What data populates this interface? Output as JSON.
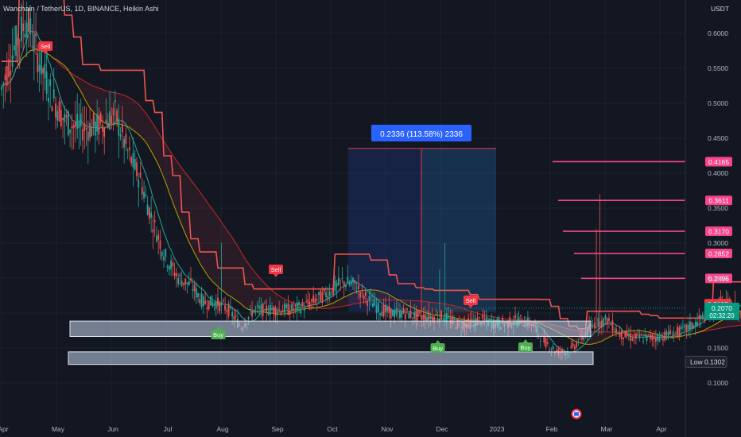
{
  "header": {
    "title": "Wanchain / TetherUS, 1D, BINANCE, Heikin Ashi",
    "currency": "USDT"
  },
  "chart_data": {
    "type": "candlestick",
    "yaxis_ticks": [
      0.6,
      0.55,
      0.5,
      0.45,
      0.4,
      0.35,
      0.3,
      0.25,
      0.2,
      0.15,
      0.1
    ],
    "yaxis_tick_labels": [
      "0.6000",
      "0.5500",
      "0.5000",
      "0.4500",
      "0.4000",
      "0.3500",
      "0.3000",
      "0.2500",
      "0.2000",
      "0.1500",
      "0.1000"
    ],
    "ylim": [
      0.0535,
      0.6335
    ],
    "xaxis_labels": [
      "Apr",
      "May",
      "Jun",
      "Jul",
      "Aug",
      "Sep",
      "Oct",
      "Nov",
      "Dec",
      "2023",
      "Feb",
      "Mar",
      "Apr"
    ],
    "price_path": [
      [
        0,
        0.5,
        0.54
      ],
      [
        1,
        0.56,
        0.6
      ],
      [
        2,
        0.58,
        0.66
      ],
      [
        3,
        0.55,
        0.57
      ],
      [
        4,
        0.5,
        0.52
      ],
      [
        5,
        0.47,
        0.48
      ],
      [
        6,
        0.46,
        0.47
      ],
      [
        7,
        0.47,
        0.46
      ],
      [
        8,
        0.48,
        0.46
      ],
      [
        9,
        0.5,
        0.47
      ],
      [
        10,
        0.45,
        0.41
      ],
      [
        11,
        0.42,
        0.36
      ],
      [
        12,
        0.36,
        0.3
      ],
      [
        13,
        0.3,
        0.26
      ],
      [
        14,
        0.26,
        0.24
      ],
      [
        15,
        0.25,
        0.23
      ],
      [
        16,
        0.22,
        0.21
      ],
      [
        17,
        0.21,
        0.22
      ],
      [
        18,
        0.22,
        0.19
      ],
      [
        19,
        0.19,
        0.17
      ],
      [
        20,
        0.2,
        0.21
      ],
      [
        21,
        0.21,
        0.2
      ],
      [
        22,
        0.2,
        0.21
      ],
      [
        23,
        0.21,
        0.2
      ],
      [
        24,
        0.2,
        0.22
      ],
      [
        25,
        0.23,
        0.21
      ],
      [
        26,
        0.22,
        0.24
      ],
      [
        27,
        0.24,
        0.25
      ],
      [
        28,
        0.25,
        0.23
      ],
      [
        29,
        0.23,
        0.21
      ],
      [
        30,
        0.21,
        0.2
      ],
      [
        31,
        0.2,
        0.2
      ],
      [
        32,
        0.2,
        0.2
      ],
      [
        33,
        0.2,
        0.19
      ],
      [
        34,
        0.19,
        0.2
      ],
      [
        35,
        0.2,
        0.19
      ],
      [
        36,
        0.19,
        0.18
      ],
      [
        37,
        0.18,
        0.19
      ],
      [
        38,
        0.19,
        0.19
      ],
      [
        39,
        0.19,
        0.18
      ],
      [
        40,
        0.18,
        0.19
      ],
      [
        41,
        0.19,
        0.19
      ],
      [
        42,
        0.19,
        0.18
      ],
      [
        43,
        0.17,
        0.15
      ],
      [
        44,
        0.15,
        0.14
      ],
      [
        45,
        0.14,
        0.15
      ],
      [
        46,
        0.15,
        0.18
      ],
      [
        47,
        0.17,
        0.2
      ],
      [
        48,
        0.2,
        0.18
      ],
      [
        49,
        0.18,
        0.16
      ],
      [
        50,
        0.16,
        0.17
      ],
      [
        51,
        0.17,
        0.16
      ],
      [
        52,
        0.16,
        0.17
      ],
      [
        53,
        0.17,
        0.17
      ],
      [
        54,
        0.17,
        0.18
      ],
      [
        55,
        0.18,
        0.19
      ],
      [
        56,
        0.19,
        0.21
      ],
      [
        57,
        0.21,
        0.22
      ],
      [
        58,
        0.22,
        0.2
      ],
      [
        59,
        0.2,
        0.19
      ],
      [
        60,
        0.19,
        0.21
      ]
    ],
    "measure_label": "0.2336 (113.58%) 2336",
    "measure_range": [
      0.2015,
      0.4355
    ],
    "signals": [
      {
        "label": "Sell",
        "kind": "sell",
        "x_month": 0.8
      },
      {
        "label": "Sell",
        "kind": "sell",
        "x_month": 5.0
      },
      {
        "label": "Sell",
        "kind": "sell",
        "x_month": 8.55
      },
      {
        "label": "Buy",
        "kind": "buy",
        "x_month": 3.95
      },
      {
        "label": "Buy",
        "kind": "buy",
        "x_month": 7.95
      },
      {
        "label": "Buy",
        "kind": "buy",
        "x_month": 9.55
      }
    ],
    "target_levels": [
      {
        "value": 0.4165,
        "label": "0.4165"
      },
      {
        "value": 0.3611,
        "label": "0.3611"
      },
      {
        "value": 0.317,
        "label": "0.3170"
      },
      {
        "value": 0.2852,
        "label": "0.2852"
      },
      {
        "value": 0.2496,
        "label": "0.2496"
      }
    ],
    "price_tags": [
      {
        "value": 0.2133,
        "label": "0.2133",
        "color": "#f23645"
      },
      {
        "value": 0.207,
        "label": "0.2070",
        "sub": "02:32:20",
        "color": "#089981"
      }
    ],
    "low_tag": {
      "text": "Low",
      "label": "0.1302",
      "value": 0.1302
    },
    "zones": [
      {
        "top": 0.1885,
        "bottom": 0.1665
      },
      {
        "top": 0.1445,
        "bottom": 0.1265
      }
    ],
    "colors": {
      "background": "#131722",
      "bull": "#26a69a",
      "bear": "#ef5350",
      "target": "#f7448a",
      "accent": "#2962ff",
      "grid": "#1e222d",
      "zone": "#c5d4ec"
    }
  }
}
